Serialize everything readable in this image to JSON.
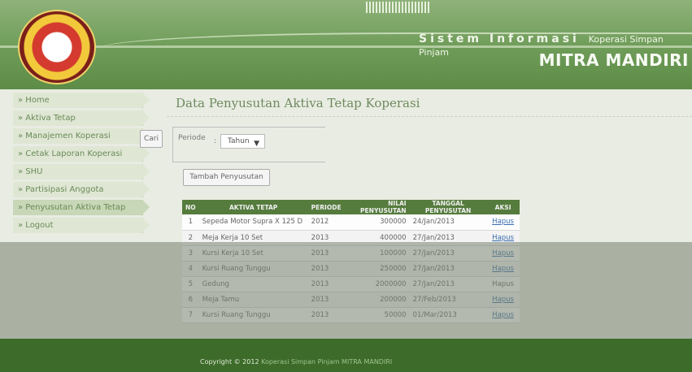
{
  "header": {
    "system_title": "Sistem Informasi",
    "system_subtitle": "Koperasi Simpan Pinjam",
    "brand": "MITRA MANDIRI",
    "logo_icon": "cooperative-logo-icon"
  },
  "sidebar": {
    "items": [
      {
        "label": "» Home"
      },
      {
        "label": "» Aktiva Tetap"
      },
      {
        "label": "» Manajemen Koperasi"
      },
      {
        "label": "» Cetak Laporan Koperasi"
      },
      {
        "label": "» SHU"
      },
      {
        "label": "» Partisipasi Anggota"
      },
      {
        "label": "» Penyusutan Aktiva Tetap"
      },
      {
        "label": "» Logout"
      }
    ]
  },
  "main": {
    "title": "Data Penyusutan Aktiva Tetap Koperasi",
    "filter": {
      "label": "Periode",
      "colon": ":",
      "selected": "Tahun",
      "search_button": "Cari"
    },
    "add_button": "Tambah Penyusutan",
    "table": {
      "headers": [
        "NO",
        "AKTIVA TETAP",
        "PERIODE",
        "NILAI PENYUSUTAN",
        "TANGGAL PENYUSUTAN",
        "AKSI"
      ],
      "rows": [
        {
          "no": "1",
          "aset": "Sepeda Motor Supra X 125 D",
          "periode": "2012",
          "nilai": "300000",
          "tanggal": "24/Jan/2013",
          "aksi": "Hapus"
        },
        {
          "no": "2",
          "aset": "Meja Kerja 10 Set",
          "periode": "2013",
          "nilai": "400000",
          "tanggal": "27/Jan/2013",
          "aksi": "Hapus"
        },
        {
          "no": "3",
          "aset": "Kursi Kerja 10 Set",
          "periode": "2013",
          "nilai": "100000",
          "tanggal": "27/Jan/2013",
          "aksi": "Hapus"
        },
        {
          "no": "4",
          "aset": "Kursi Ruang Tunggu",
          "periode": "2013",
          "nilai": "250000",
          "tanggal": "27/Jan/2013",
          "aksi": "Hapus"
        },
        {
          "no": "5",
          "aset": "Gedung",
          "periode": "2013",
          "nilai": "2000000",
          "tanggal": "27/Jan/2013",
          "aksi": "Hapus"
        },
        {
          "no": "6",
          "aset": "Meja Tamu",
          "periode": "2013",
          "nilai": "200000",
          "tanggal": "27/Feb/2013",
          "aksi": "Hapus"
        },
        {
          "no": "7",
          "aset": "Kursi Ruang Tunggu",
          "periode": "2013",
          "nilai": "50000",
          "tanggal": "01/Mar/2013",
          "aksi": "Hapus"
        }
      ]
    }
  },
  "footer": {
    "copyright": "Copyright © 2012",
    "org": "Koperasi Simpan Pinjam MITRA MANDIRI"
  },
  "colors": {
    "header_green": "#6e9c58",
    "footer_green": "#3c6b2a",
    "table_header": "#557c3d",
    "link_blue": "#3a6db0"
  }
}
